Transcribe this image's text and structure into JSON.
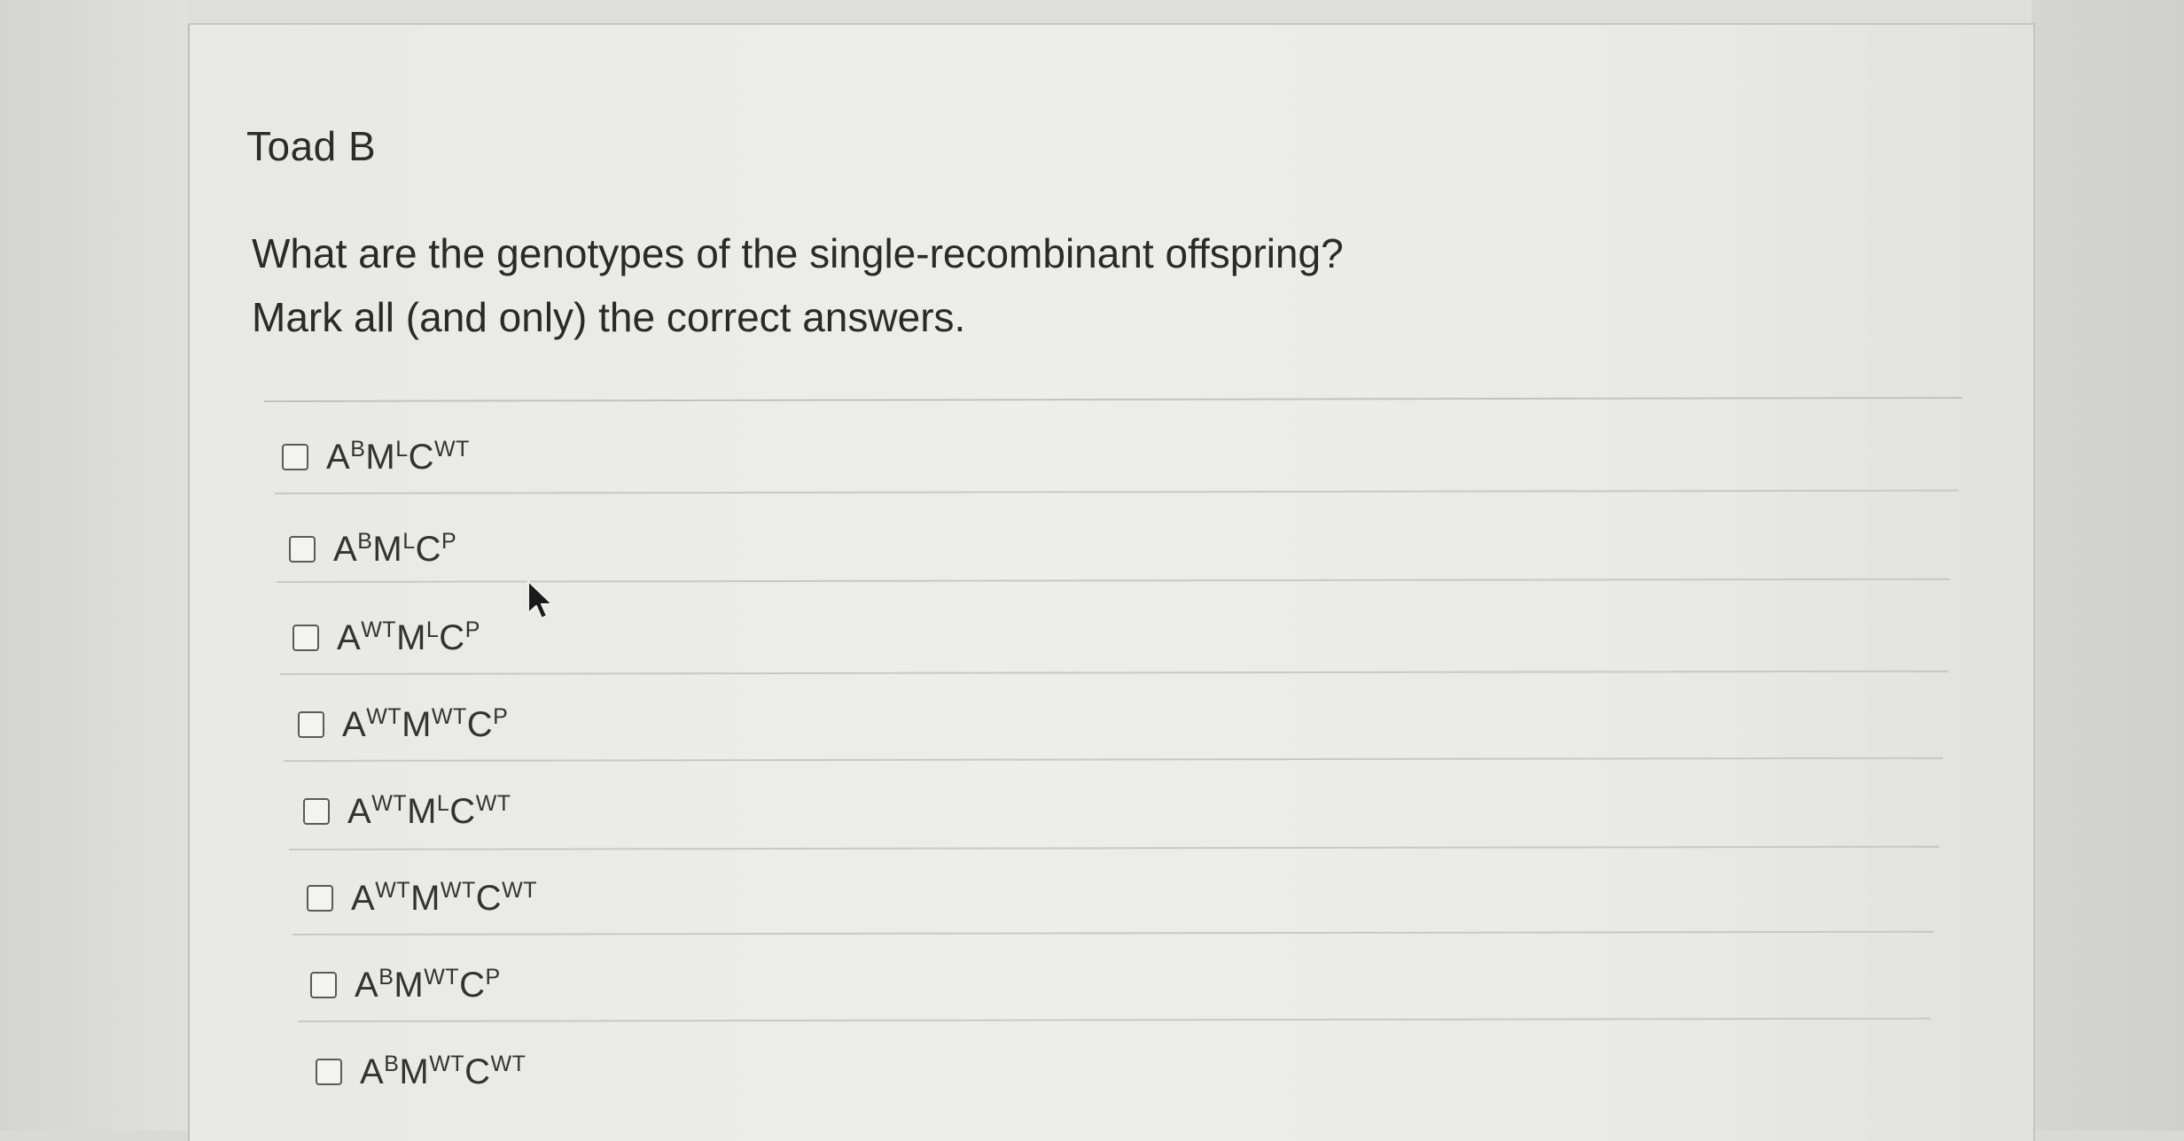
{
  "page": {
    "title": "Toad B",
    "question_line1": "What are the genotypes of the single-recombinant offspring?",
    "question_line2": "Mark all (and only) the correct answers."
  },
  "options": [
    {
      "checked": false,
      "parts": [
        {
          "base": "A",
          "sup": "B"
        },
        {
          "base": "M",
          "sup": "L"
        },
        {
          "base": "C",
          "sup": "WT"
        }
      ]
    },
    {
      "checked": false,
      "parts": [
        {
          "base": "A",
          "sup": "B"
        },
        {
          "base": "M",
          "sup": "L"
        },
        {
          "base": "C",
          "sup": "P"
        }
      ]
    },
    {
      "checked": false,
      "parts": [
        {
          "base": "A",
          "sup": "WT"
        },
        {
          "base": "M",
          "sup": "L"
        },
        {
          "base": "C",
          "sup": "P"
        }
      ]
    },
    {
      "checked": false,
      "parts": [
        {
          "base": "A",
          "sup": "WT"
        },
        {
          "base": "M",
          "sup": "WT"
        },
        {
          "base": "C",
          "sup": "P"
        }
      ]
    },
    {
      "checked": false,
      "parts": [
        {
          "base": "A",
          "sup": "WT"
        },
        {
          "base": "M",
          "sup": "L"
        },
        {
          "base": "C",
          "sup": "WT"
        }
      ]
    },
    {
      "checked": false,
      "parts": [
        {
          "base": "A",
          "sup": "WT"
        },
        {
          "base": "M",
          "sup": "WT"
        },
        {
          "base": "C",
          "sup": "WT"
        }
      ]
    },
    {
      "checked": false,
      "parts": [
        {
          "base": "A",
          "sup": "B"
        },
        {
          "base": "M",
          "sup": "WT"
        },
        {
          "base": "C",
          "sup": "P"
        }
      ]
    },
    {
      "checked": false,
      "parts": [
        {
          "base": "A",
          "sup": "B"
        },
        {
          "base": "M",
          "sup": "WT"
        },
        {
          "base": "C",
          "sup": "WT"
        }
      ]
    }
  ],
  "colors": {
    "text": "#2a2a2a",
    "checkbox_border": "#5a5a5a",
    "divider": "#c8c8c6"
  },
  "icons": {
    "cursor": "mouse-pointer-icon"
  }
}
